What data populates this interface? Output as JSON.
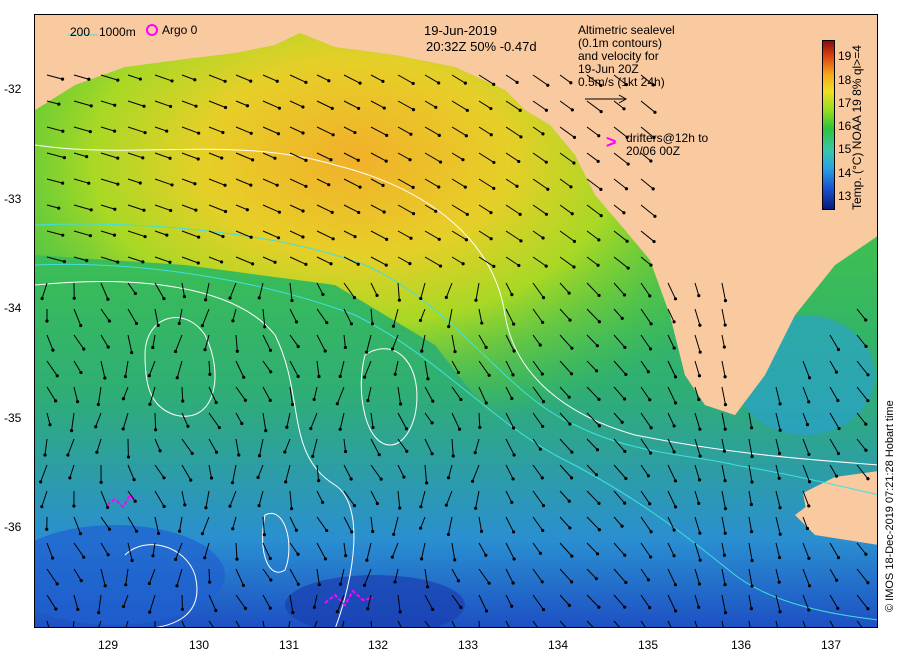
{
  "header": {
    "date": "19-Jun-2019",
    "time_line": "20:32Z  50% -0.47d"
  },
  "legend": {
    "isobath_200": "200",
    "isobath_1000": "1000m",
    "argo": "Argo 0",
    "altimetry_lines": [
      "Altimetric sealevel",
      "(0.1m contours)",
      "and velocity for",
      "19-Jun 20Z",
      "0.5m/s (1kt 24h)"
    ],
    "drifter_lines": [
      "drifters@12h to",
      "20/06 00Z"
    ]
  },
  "axes": {
    "y_ticks": [
      "-32",
      "-33",
      "-34",
      "-35",
      "-36"
    ],
    "x_ticks": [
      "129",
      "130",
      "131",
      "132",
      "133",
      "134",
      "135",
      "136",
      "137"
    ]
  },
  "colorbar": {
    "labels": [
      "19",
      "18",
      "17",
      "16",
      "15",
      "14",
      "13"
    ],
    "title": "Temp. (°C) NOAA 19  8% ql>=4",
    "range": [
      12.5,
      19.5
    ]
  },
  "credit": "© IMOS 18-Dec-2019 07:21:28 Hobart time",
  "colors": {
    "land": "#f9c9a0",
    "isobath": "#40e0e0",
    "drifter": "#ff00ff",
    "contour": "#ffffff"
  }
}
